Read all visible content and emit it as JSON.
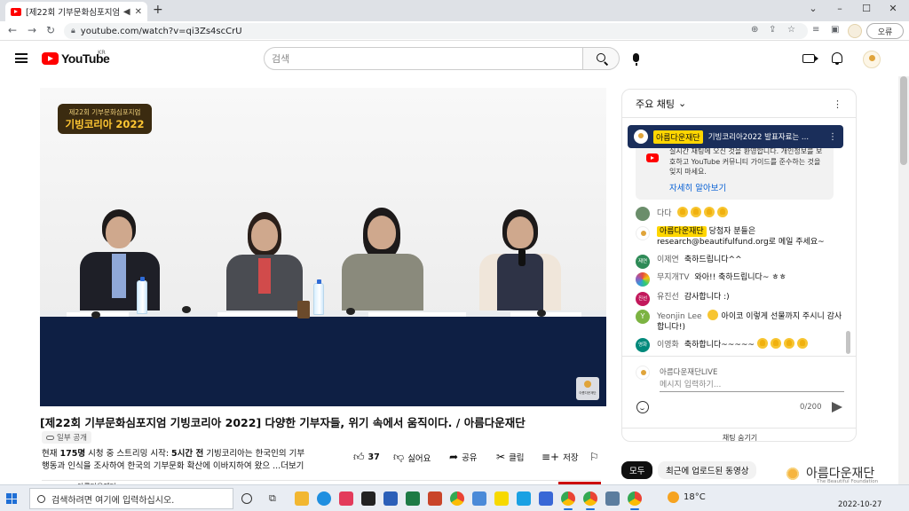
{
  "browser": {
    "tab_title": "[제22회 기부문화심포지엄 기",
    "url": "youtube.com/watch?v=qi3Zs4scCrU",
    "error_label": "오류",
    "new_tab": "+",
    "win_min": "–",
    "win_max": "☐",
    "win_close": "✕",
    "dropdown": "⌄"
  },
  "youtube_header": {
    "logo_text": "YouTube",
    "region": "KR",
    "search_placeholder": "검색"
  },
  "video": {
    "badge_line1": "제22회 기부문화심포지엄",
    "badge_line2": "기빙코리아 2022",
    "watermark": "아름다운재단"
  },
  "under_video": {
    "title": "[제22회 기부문화심포지엄 기빙코리아 2022] 다양한 기부자들, 위기 속에서 움직이다. / 아름다운재단",
    "visibility": "일부 공개",
    "stats_prefix": "현재 ",
    "viewers": "175명",
    "stats_mid": " 시청 중  스트리밍 시작: ",
    "started": "5시간 전",
    "desc_line1_rest": "  기빙코리아는 한국인의 기부",
    "desc_line2": "행동과 인식을 조사하여 한국의 기부문화 확산에 이바지하여 왔으 ",
    "more": "...더보기",
    "like_count": "37",
    "dislike_label": "싫어요",
    "share_label": "공유",
    "clip_label": "클립",
    "save_label": "저장",
    "channel_name": "아름다운재단"
  },
  "chat": {
    "header": "주요 채팅",
    "pinned_owner": "아름다운재단",
    "pinned_text": "기빙코리아2022 발표자료는 ...",
    "notice_text": "실시간 채팅에 오신 것을 환영합니다. 개인정보를 보호하고 YouTube 커뮤니티 가이드를 준수하는 것을 잊지 마세요.",
    "notice_link": "자세히 알아보기",
    "messages": [
      {
        "author": "다다",
        "text": "",
        "emojis": 4
      },
      {
        "author": "아름다운재단",
        "text": "당첨자 분들은 research@beautifulfund.org로 메일 주세요~",
        "owner": true
      },
      {
        "author": "이제연",
        "text": "축하드립니다^^",
        "badge": "제연"
      },
      {
        "author": "무지개TV",
        "text": "와아!! 축하드립니다~ ㅎㅎ"
      },
      {
        "author": "유진선",
        "text": "감사합니다 :)",
        "badge": "진선"
      },
      {
        "author": "Yeonjin Lee",
        "text": "아이코 이렇게 선물까지 주시니 감사합니다!)",
        "badge": "Y"
      },
      {
        "author": "이영화",
        "text": "축하합니다~~~~~",
        "badge": "영화",
        "emojis": 4
      }
    ],
    "viewer_name": "아름다운재단LIVE",
    "input_placeholder": "메시지 입력하기...",
    "char_count": "0/200",
    "hide_chat": "채팅 숨기기"
  },
  "chips": {
    "all": "모두",
    "recent": "최근에 업로드된 동영상"
  },
  "brand_watermark": {
    "name": "아름다운재단",
    "sub": "The Beautiful Foundation"
  },
  "taskbar": {
    "search_placeholder": "검색하려면 여기에 입력하십시오.",
    "weather": "18°C",
    "date": "2022-10-27"
  },
  "colors": {
    "youtube_red": "#ff0000",
    "pinned_bg": "#1a2e5a",
    "owner_chip": "#ffd600",
    "link_blue": "#065fd4"
  }
}
